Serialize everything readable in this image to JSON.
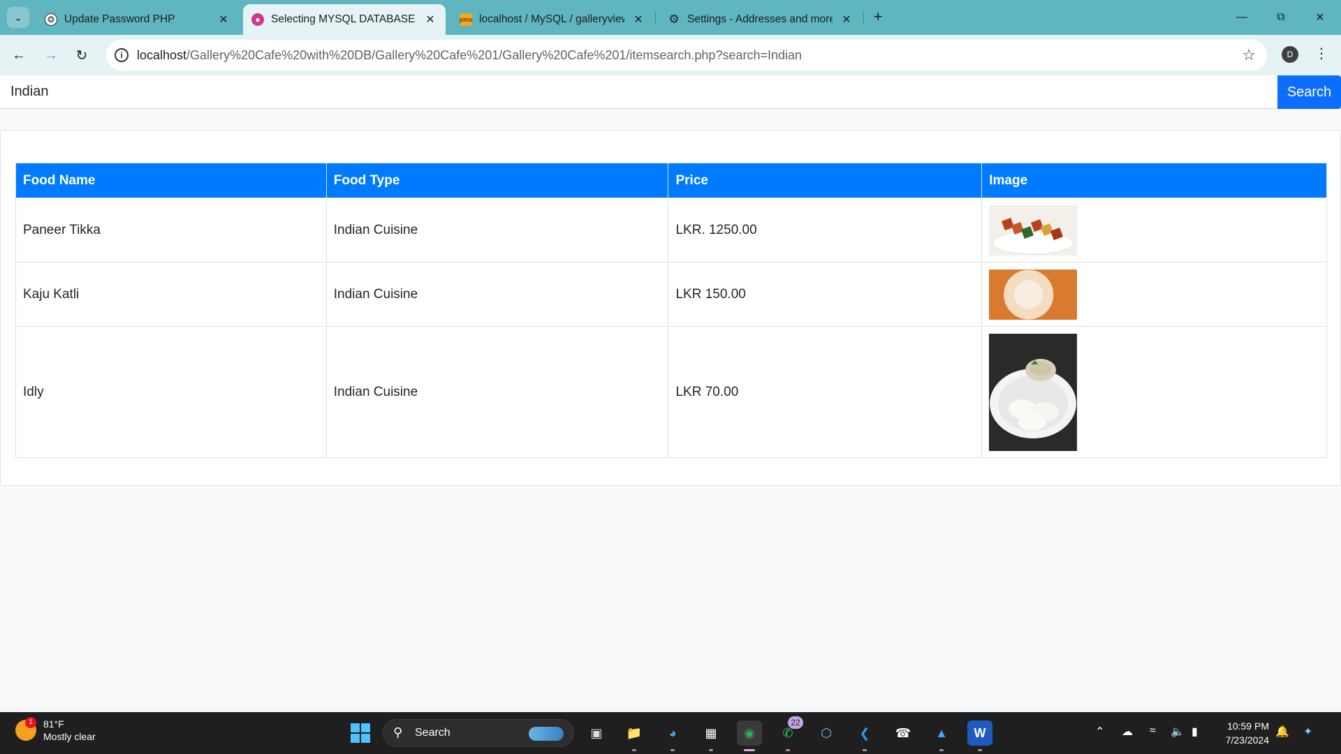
{
  "browser": {
    "tabs": [
      {
        "title": "Update Password PHP",
        "favicon": "chatgpt-icon"
      },
      {
        "title": "Selecting MYSQL DATABASE (G",
        "favicon": "claude-icon"
      },
      {
        "title": "localhost / MySQL / galleryview",
        "favicon": "phpmyadmin-icon"
      },
      {
        "title": "Settings - Addresses and more",
        "favicon": "gear-icon"
      }
    ],
    "active_tab": 1,
    "url_host": "localhost",
    "url_path": "/Gallery%20Cafe%20with%20DB/Gallery%20Cafe%201/Gallery%20Cafe%201/itemsearch.php?search=Indian",
    "profile_initial": "D"
  },
  "search": {
    "value": "Indian",
    "button_label": "Search"
  },
  "results": {
    "headers": [
      "Food Name",
      "Food Type",
      "Price",
      "Image"
    ],
    "rows": [
      {
        "name": "Paneer Tikka",
        "type": "Indian Cuisine",
        "price": "LKR. 1250.00"
      },
      {
        "name": "Kaju Katli",
        "type": "Indian Cuisine",
        "price": "LKR 150.00"
      },
      {
        "name": "Idly",
        "type": "Indian Cuisine",
        "price": "LKR 70.00"
      }
    ]
  },
  "taskbar": {
    "weather_temp": "81°F",
    "weather_desc": "Mostly clear",
    "weather_badge": "1",
    "search_label": "Search",
    "whatsapp_badge": "22",
    "time": "10:59 PM",
    "date": "7/23/2024"
  },
  "colors": {
    "tabstrip": "#5fb6c1",
    "table_header": "#007bff",
    "search_button": "#0d6efd"
  }
}
